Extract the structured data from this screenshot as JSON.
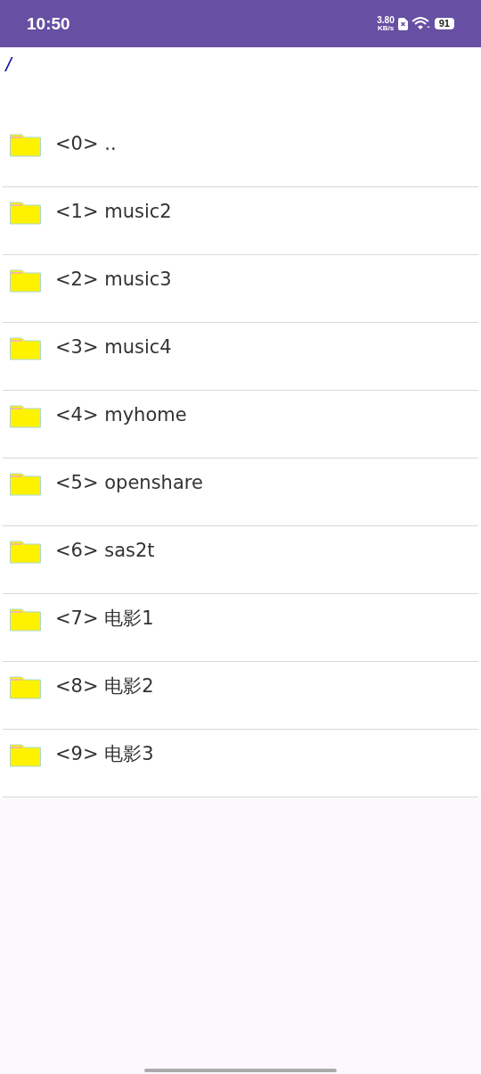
{
  "status_bar": {
    "time": "10:50",
    "net_speed": "3.80",
    "net_unit": "KB/s",
    "battery": "91"
  },
  "path": "/",
  "entries": [
    {
      "label": "<0> .."
    },
    {
      "label": "<1> music2"
    },
    {
      "label": "<2> music3"
    },
    {
      "label": "<3> music4"
    },
    {
      "label": "<4> myhome"
    },
    {
      "label": "<5> openshare"
    },
    {
      "label": "<6> sas2t"
    },
    {
      "label": "<7> 电影1"
    },
    {
      "label": "<8> 电影2"
    },
    {
      "label": "<9> 电影3"
    }
  ]
}
